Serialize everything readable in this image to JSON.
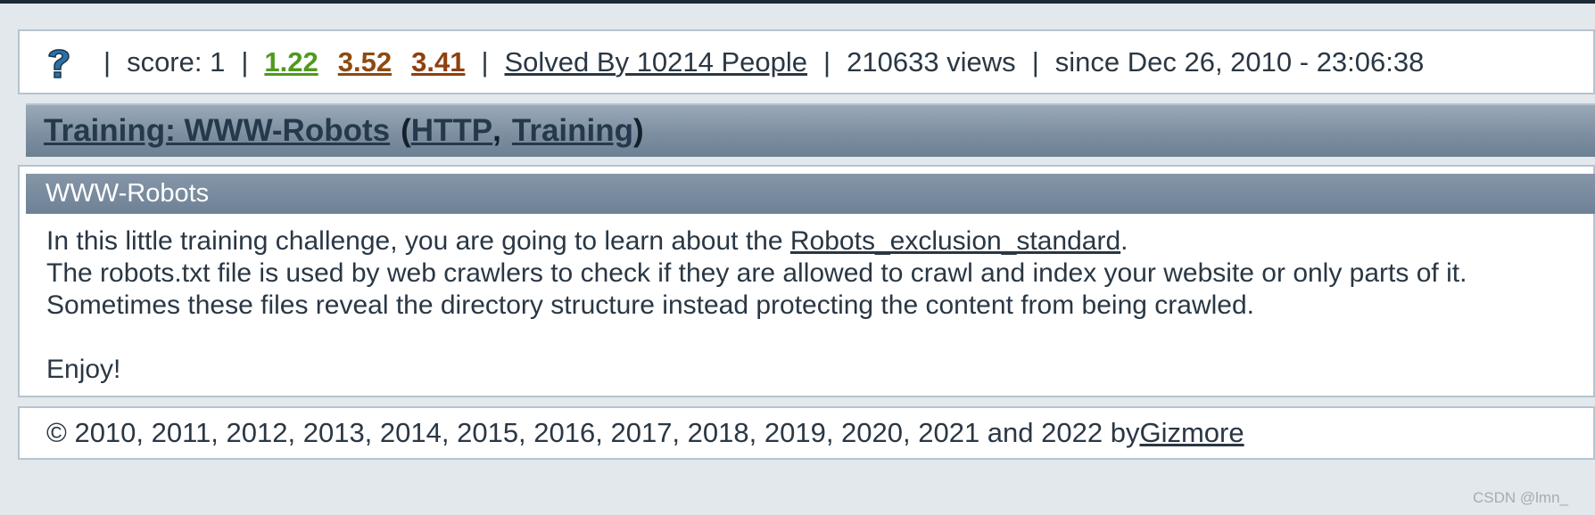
{
  "stats": {
    "icon": "question-mark-icon",
    "score": "score: 1",
    "votes": [
      "1.22",
      "3.52",
      "3.41"
    ],
    "solved_link": "Solved By 10214 People",
    "views": "210633 views",
    "since": "since Dec 26, 2010 - 23:06:38",
    "separator": "|"
  },
  "title_bar": {
    "title_link": "Training: WWW-Robots",
    "open_paren": "(",
    "tag1": "HTTP",
    "comma": ",",
    "tag2": "Training",
    "close_paren": ")"
  },
  "content": {
    "header": "WWW-Robots",
    "line1_prefix": "In this little training challenge, you are going to learn about the ",
    "line1_link": "Robots_exclusion_standard",
    "line1_suffix": ".",
    "line2": "The robots.txt file is used by web crawlers to check if they are allowed to crawl and index your website or only parts of it.",
    "line3": "Sometimes these files reveal the directory structure instead protecting the content from being crawled.",
    "line4": "Enjoy!"
  },
  "footer": {
    "copyright_prefix": "© 2010, 2011, 2012, 2013, 2014, 2015, 2016, 2017, 2018, 2019, 2020, 2021 and 2022 by ",
    "author_link": "Gizmore"
  },
  "watermark": "CSDN @lmn_",
  "colors": {
    "vote_green": "#4f9a1e",
    "vote_brown": "#8d4a10",
    "vote_rust": "#8f3f10",
    "title_bar": "#7d8fa1",
    "header_bar": "#6e8195"
  }
}
